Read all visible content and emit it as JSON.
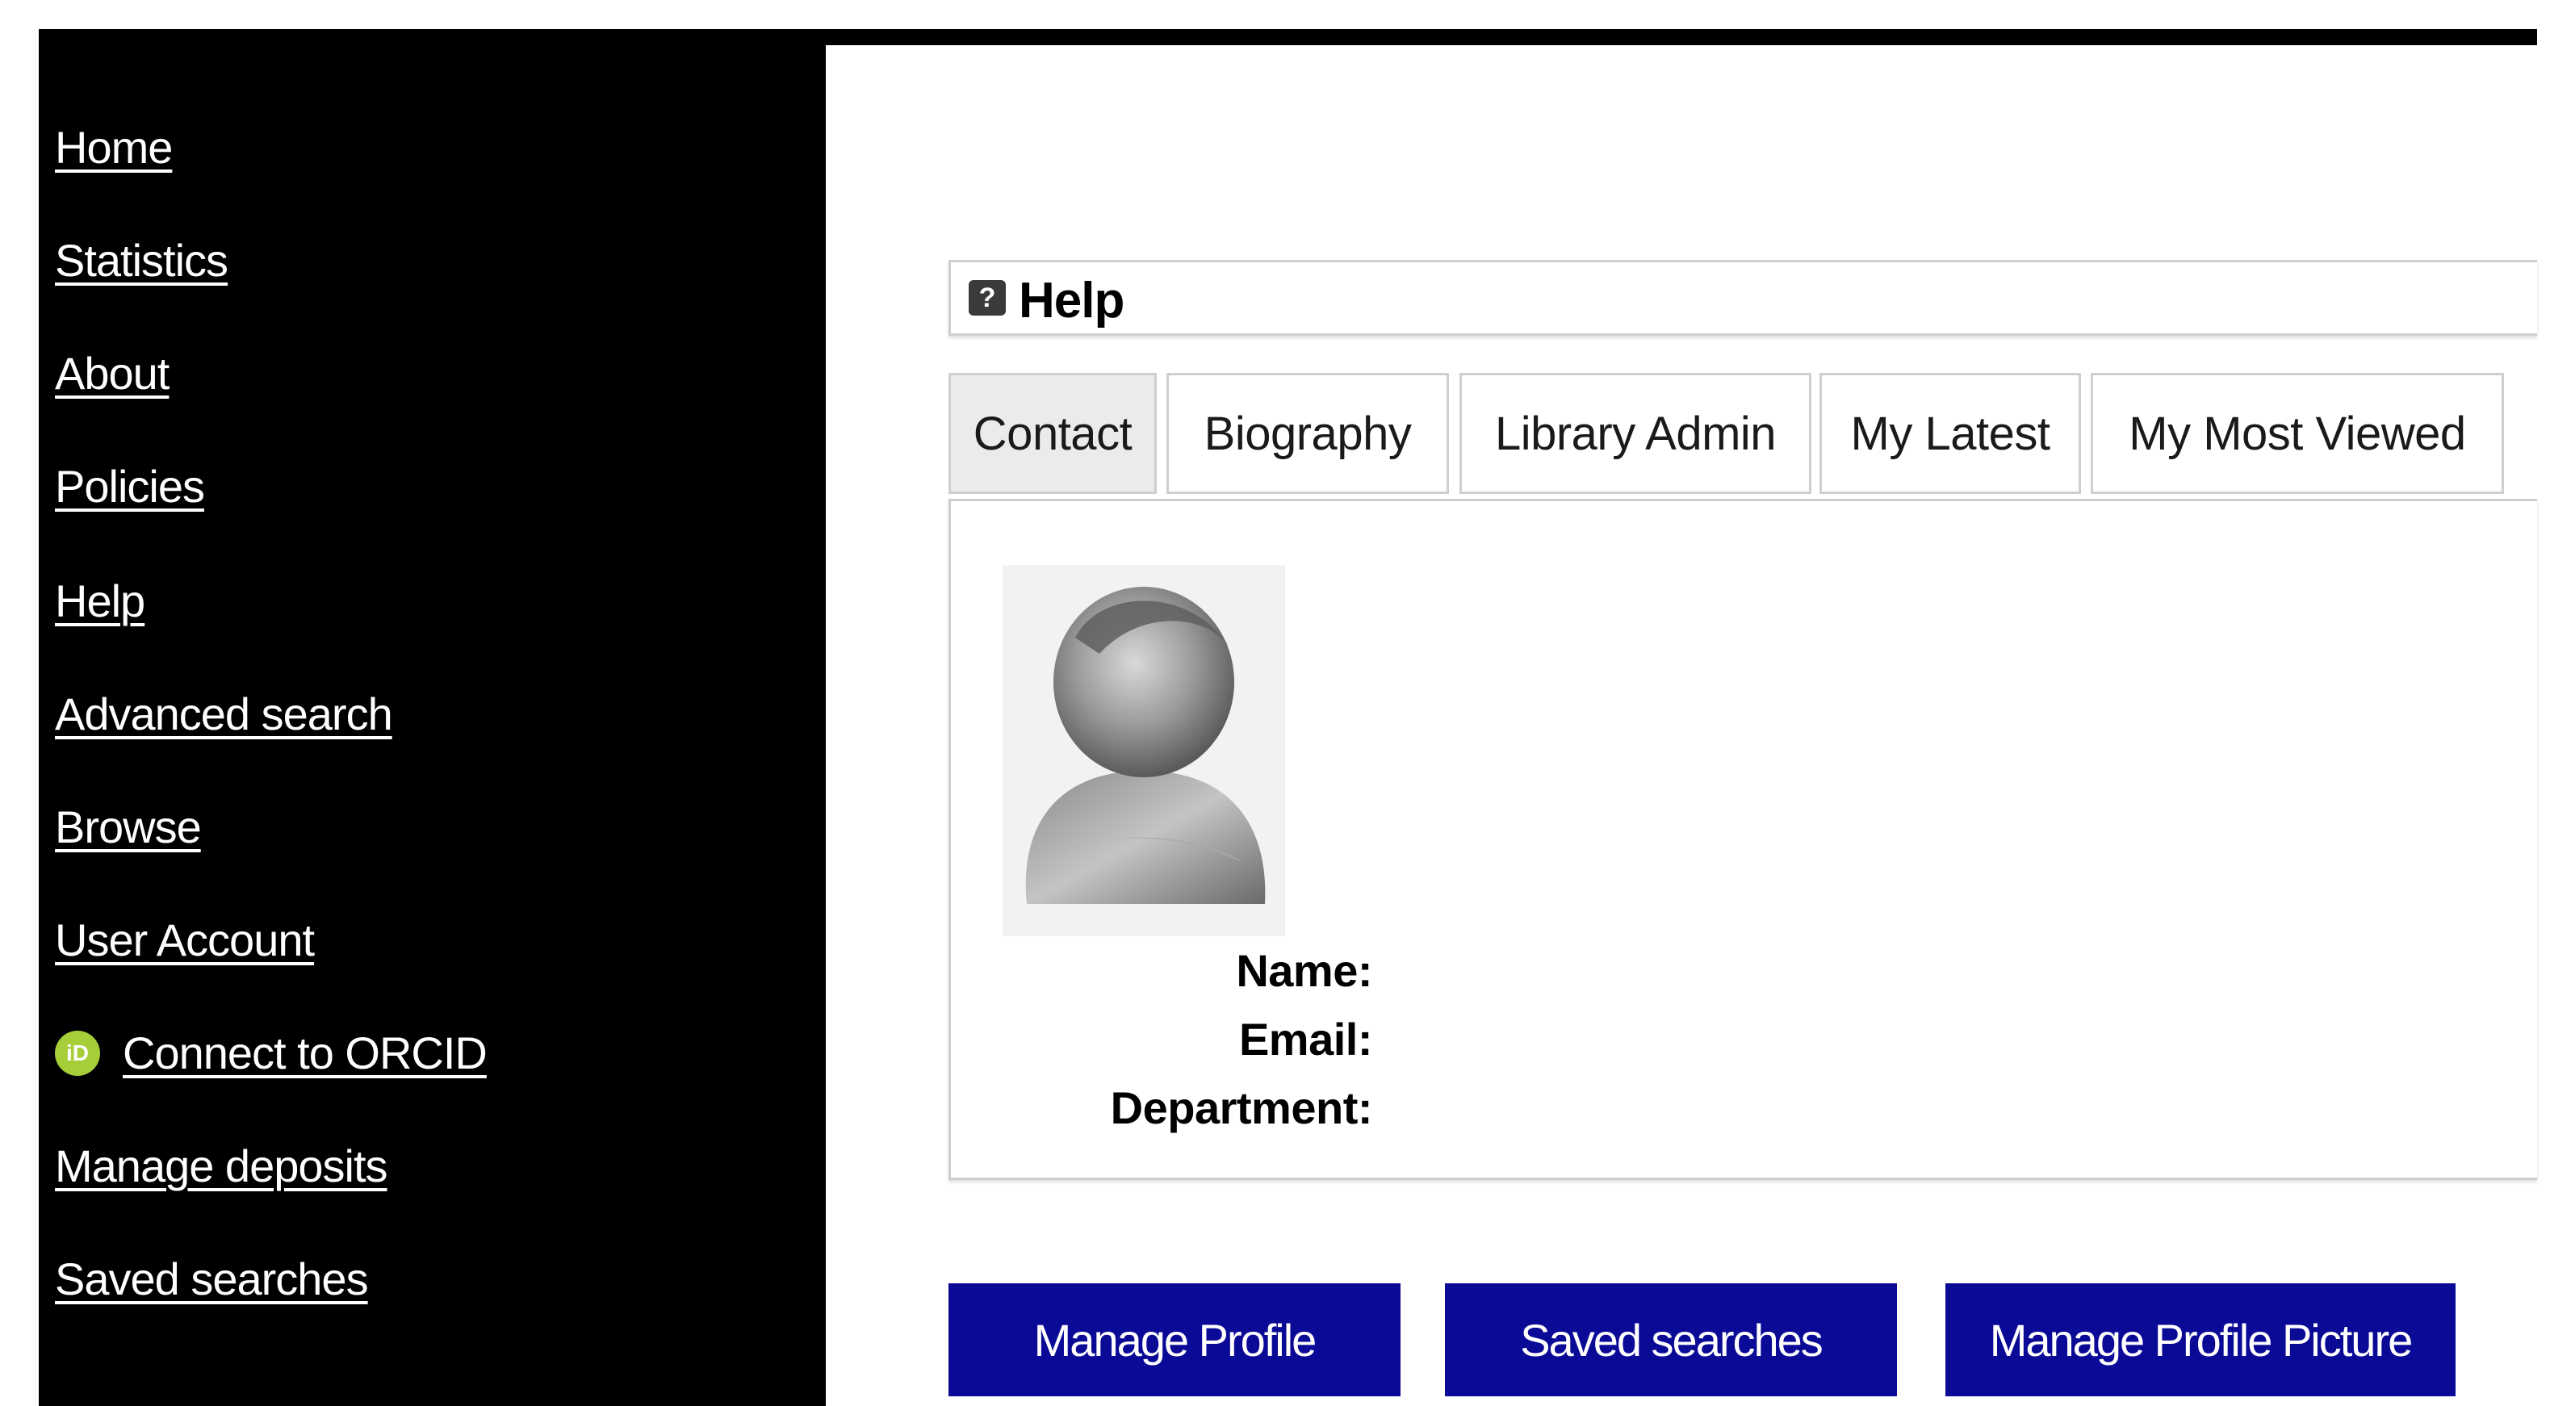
{
  "sidebar": {
    "items": [
      {
        "label": "Home"
      },
      {
        "label": "Statistics"
      },
      {
        "label": "About"
      },
      {
        "label": "Policies"
      },
      {
        "label": "Help"
      },
      {
        "label": "Advanced search"
      },
      {
        "label": "Browse"
      },
      {
        "label": "User Account"
      },
      {
        "label": "Connect to ORCID",
        "icon": "orcid-icon",
        "icon_text": "iD"
      },
      {
        "label": "Manage deposits"
      },
      {
        "label": "Saved searches"
      }
    ]
  },
  "help": {
    "icon": "question-icon",
    "icon_glyph": "?",
    "title": "Help"
  },
  "tabs": [
    {
      "label": "Contact",
      "active": true
    },
    {
      "label": "Biography",
      "active": false
    },
    {
      "label": "Library Admin",
      "active": false
    },
    {
      "label": "My Latest",
      "active": false
    },
    {
      "label": "My Most Viewed",
      "active": false
    }
  ],
  "profile": {
    "avatar_icon": "user-avatar-icon",
    "fields": [
      {
        "label": "Name:"
      },
      {
        "label": "Email:"
      },
      {
        "label": "Department:"
      }
    ]
  },
  "buttons": [
    {
      "label": "Manage Profile"
    },
    {
      "label": "Saved searches"
    },
    {
      "label": "Manage Profile Picture"
    }
  ],
  "colors": {
    "sidebar_bg": "#000000",
    "sidebar_text": "#ffffff",
    "button_bg": "#0a0a96",
    "orcid_green": "#a6ce39",
    "tab_active_bg": "#ebebeb",
    "border": "#cfcfcf"
  }
}
